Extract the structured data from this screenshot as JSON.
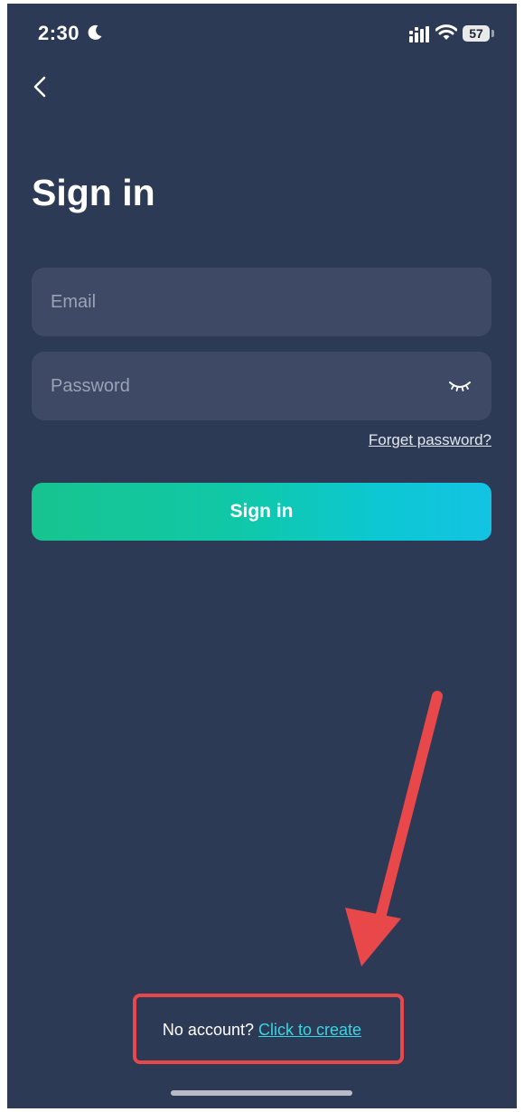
{
  "status_bar": {
    "time": "2:30",
    "battery": "57"
  },
  "icons": {
    "back": "chevron-left-icon",
    "moon": "moon-icon",
    "signal": "cellular-signal-icon",
    "wifi": "wifi-icon",
    "password_toggle": "eye-closed-icon",
    "annotation_arrow": "arrow-icon"
  },
  "page": {
    "title": "Sign in"
  },
  "form": {
    "email_placeholder": "Email",
    "password_placeholder": "Password",
    "forgot_password": "Forget password?",
    "submit_label": "Sign in"
  },
  "footer": {
    "prompt": "No account?",
    "create_link": "Click to create"
  },
  "colors": {
    "background": "#2c3a55",
    "field_background": "#3e4a65",
    "button_gradient_start": "#17c48f",
    "button_gradient_end": "#13c3e3",
    "link_accent": "#37d6e2",
    "annotation_red": "#e8484a"
  }
}
